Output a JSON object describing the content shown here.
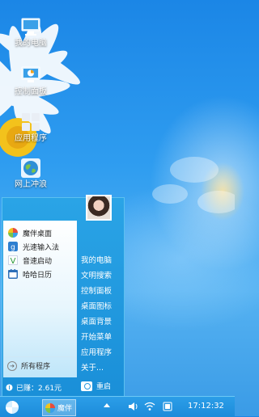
{
  "desktop": {
    "icons": [
      {
        "label": "我的电脑",
        "icon": "computer-icon"
      },
      {
        "label": "控制面板",
        "icon": "control-panel-icon"
      },
      {
        "label": "应用程序",
        "icon": "apps-icon"
      },
      {
        "label": "网上冲浪",
        "icon": "globe-icon"
      }
    ]
  },
  "start_menu": {
    "apps": [
      {
        "label": "魔伴桌面",
        "icon": "pinwheel-icon"
      },
      {
        "label": "光速输入法",
        "icon": "g-icon"
      },
      {
        "label": "音速启动",
        "icon": "v-icon"
      },
      {
        "label": "哈哈日历",
        "icon": "calendar-icon"
      }
    ],
    "all_programs": "所有程序",
    "right_items": [
      "我的电脑",
      "文明搜索",
      "控制面板",
      "桌面图标",
      "桌面背景",
      "开始菜单",
      "应用程序",
      "关于..."
    ],
    "earned": "已赚：2.61元",
    "restart": "重启"
  },
  "taskbar": {
    "app_label": "魔伴",
    "clock": "17:12:32"
  },
  "colors": {
    "accent": "#1c8bda",
    "panel": "#e8f6fd"
  }
}
